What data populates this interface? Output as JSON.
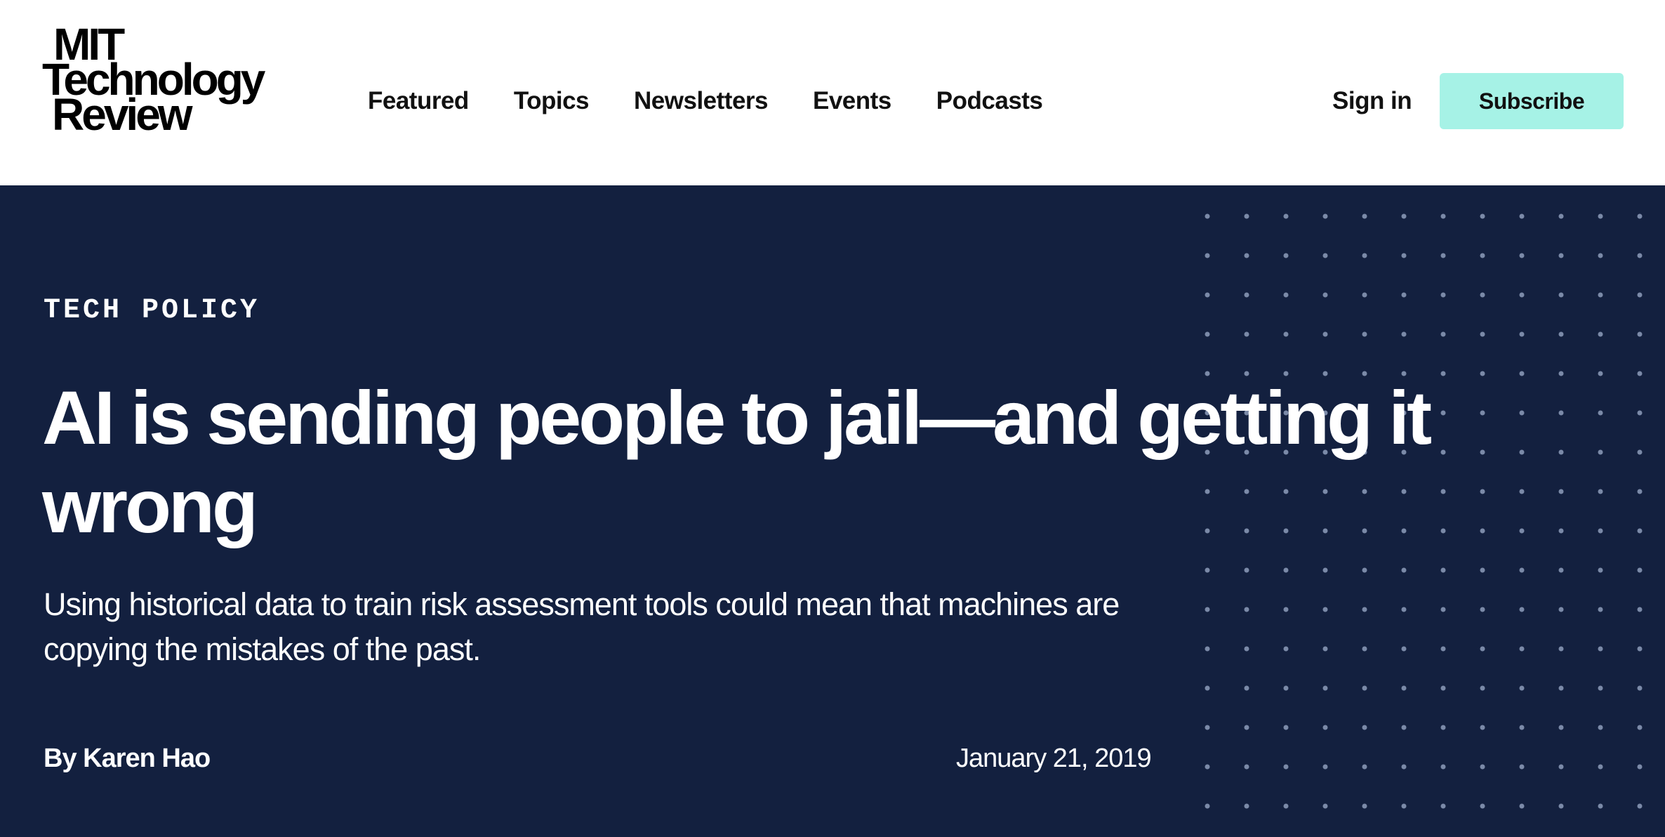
{
  "colors": {
    "header_bg": "#ffffff",
    "hero_bg": "#13203f",
    "hero_text": "#ffffff",
    "accent": "#a6f2e6",
    "dot": "#7b8aa8",
    "nav_text": "#111111"
  },
  "brand": {
    "logo_line1": "MIT",
    "logo_line2": "Technology",
    "logo_line3": "Review"
  },
  "nav": {
    "items": [
      {
        "label": "Featured"
      },
      {
        "label": "Topics"
      },
      {
        "label": "Newsletters"
      },
      {
        "label": "Events"
      },
      {
        "label": "Podcasts"
      }
    ],
    "sign_in": "Sign in",
    "subscribe": "Subscribe"
  },
  "article": {
    "topic": "TECH POLICY",
    "headline": "AI is sending people to jail—and getting it wrong",
    "dek": "Using historical data to train risk assessment tools could mean that machines are copying the mistakes of the past.",
    "byline_prefix": "By ",
    "author": "Karen Hao",
    "date": "January 21, 2019"
  }
}
